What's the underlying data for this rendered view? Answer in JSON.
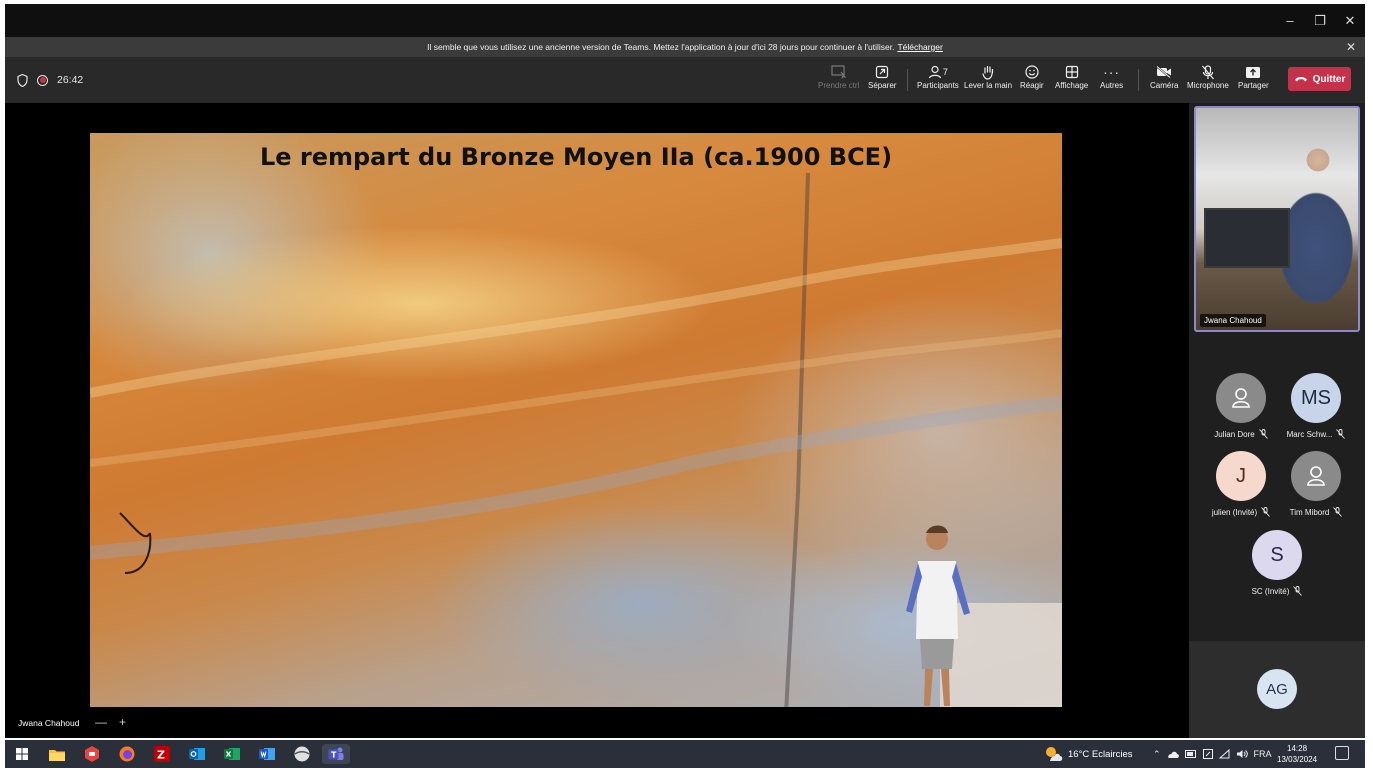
{
  "window": {
    "minimize": "–",
    "restore": "❐",
    "close": "✕"
  },
  "banner": {
    "text": "Il semble que vous utilisez une ancienne version de Teams. Mettez l'application à jour d'ici 28 jours pour continuer à l'utiliser.",
    "link": "Télécharger",
    "close": "✕"
  },
  "meeting": {
    "timer": "26:42",
    "toolbar": {
      "prendre_ctrl": "Prendre ctrl",
      "separer": "Séparer",
      "participants": "Participants",
      "participants_count": "7",
      "lever_main": "Lever la main",
      "reagir": "Réagir",
      "affichage": "Affichage",
      "autres": "Autres",
      "camera": "Caméra",
      "microphone": "Microphone",
      "partager": "Partager",
      "quitter": "Quitter"
    }
  },
  "stage": {
    "slide_title": "Le rempart du Bronze Moyen IIa (ca.1900 BCE)",
    "presenter_name": "Jwana Chahoud",
    "ctrl_minus": "—",
    "ctrl_plus": "+"
  },
  "panel": {
    "presenter_name": "Jwana Chahoud",
    "participants": [
      {
        "name": "Julian Dore",
        "initials": ""
      },
      {
        "name": "Marc Schw...",
        "initials": "MS"
      },
      {
        "name": "julien (Invité)",
        "initials": "J"
      },
      {
        "name": "Tim Mibord",
        "initials": ""
      },
      {
        "name": "SC (Invité)",
        "initials": "S"
      }
    ],
    "bottom_initials": "AG"
  },
  "taskbar": {
    "weather": "16°C  Eclaircies",
    "lang": "FRA",
    "time": "14:28",
    "date": "13/03/2024"
  },
  "colors": {
    "quit": "#c4314b",
    "accent_border": "#8b8cc7",
    "rec": "#d13438"
  }
}
